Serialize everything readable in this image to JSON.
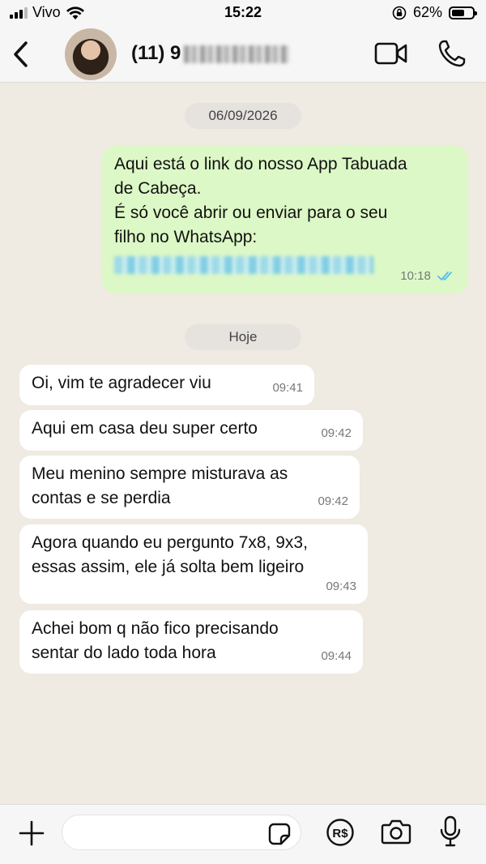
{
  "status_bar": {
    "carrier": "Vivo",
    "time": "15:22",
    "battery": "62%",
    "battery_level": 0.62,
    "icons": [
      "signal-icon",
      "wifi-icon",
      "rotation-lock-icon",
      "battery-icon"
    ]
  },
  "header": {
    "contact_name": "(11) 9",
    "contact_name_redacted": true,
    "icons": [
      "back-chevron-icon",
      "avatar",
      "video-call-icon",
      "phone-icon"
    ]
  },
  "chat": {
    "outgoing": {
      "date": "06/09/2026",
      "lines": [
        "Aqui está o link do nosso App Tabuada",
        "de Cabeça.",
        "É só você abrir ou enviar para o seu",
        "filho no WhatsApp:"
      ],
      "link_redacted": true,
      "time": "10:18",
      "status_icon": "double-check-icon",
      "status_color": "#53bdeb"
    },
    "today_label": "Hoje",
    "incoming": [
      {
        "lines": [
          "Oi, vim te agradecer viu"
        ],
        "time": "09:41"
      },
      {
        "lines": [
          "Aqui em casa deu super certo"
        ],
        "time": "09:42"
      },
      {
        "lines": [
          "Meu menino sempre misturava as",
          "contas e se perdia"
        ],
        "time": "09:42"
      },
      {
        "lines": [
          "Agora quando eu pergunto 7x8, 9x3,",
          "essas assim, ele já solta bem ligeiro"
        ],
        "time": "09:43"
      },
      {
        "lines": [
          "Achei bom q não fico precisando",
          "sentar do lado toda hora"
        ],
        "time": "09:44"
      }
    ]
  },
  "composer": {
    "input_value": "",
    "placeholder": "",
    "pay_label": "R$",
    "icons": [
      "plus-icon",
      "sticker-icon",
      "payment-icon",
      "camera-icon",
      "microphone-icon"
    ]
  },
  "colors": {
    "background": "#efeae2",
    "outgoing_bubble": "#dcf8c6",
    "incoming_bubble": "#ffffff",
    "bars": "#f6f6f6"
  }
}
